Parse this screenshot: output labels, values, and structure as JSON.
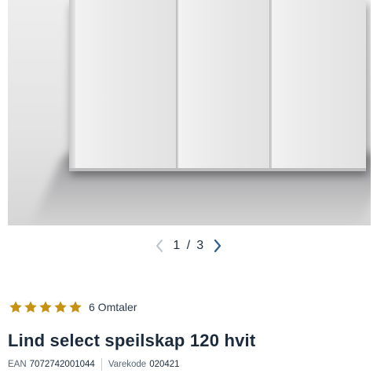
{
  "gallery": {
    "current": "1",
    "separator": "/",
    "total": "3",
    "prev_icon": "chevron-left-icon",
    "next_icon": "chevron-right-icon",
    "prev_color": "#b9c2cc",
    "next_color": "#2f5d8a"
  },
  "rating": {
    "stars": 5,
    "star_color": "#c69214",
    "reviews_label": "6 Omtaler"
  },
  "product": {
    "title": "Lind select speilskap 120 hvit",
    "ean_label": "EAN",
    "ean_value": "7072742001044",
    "sku_label": "Varekode",
    "sku_value": "020421"
  }
}
